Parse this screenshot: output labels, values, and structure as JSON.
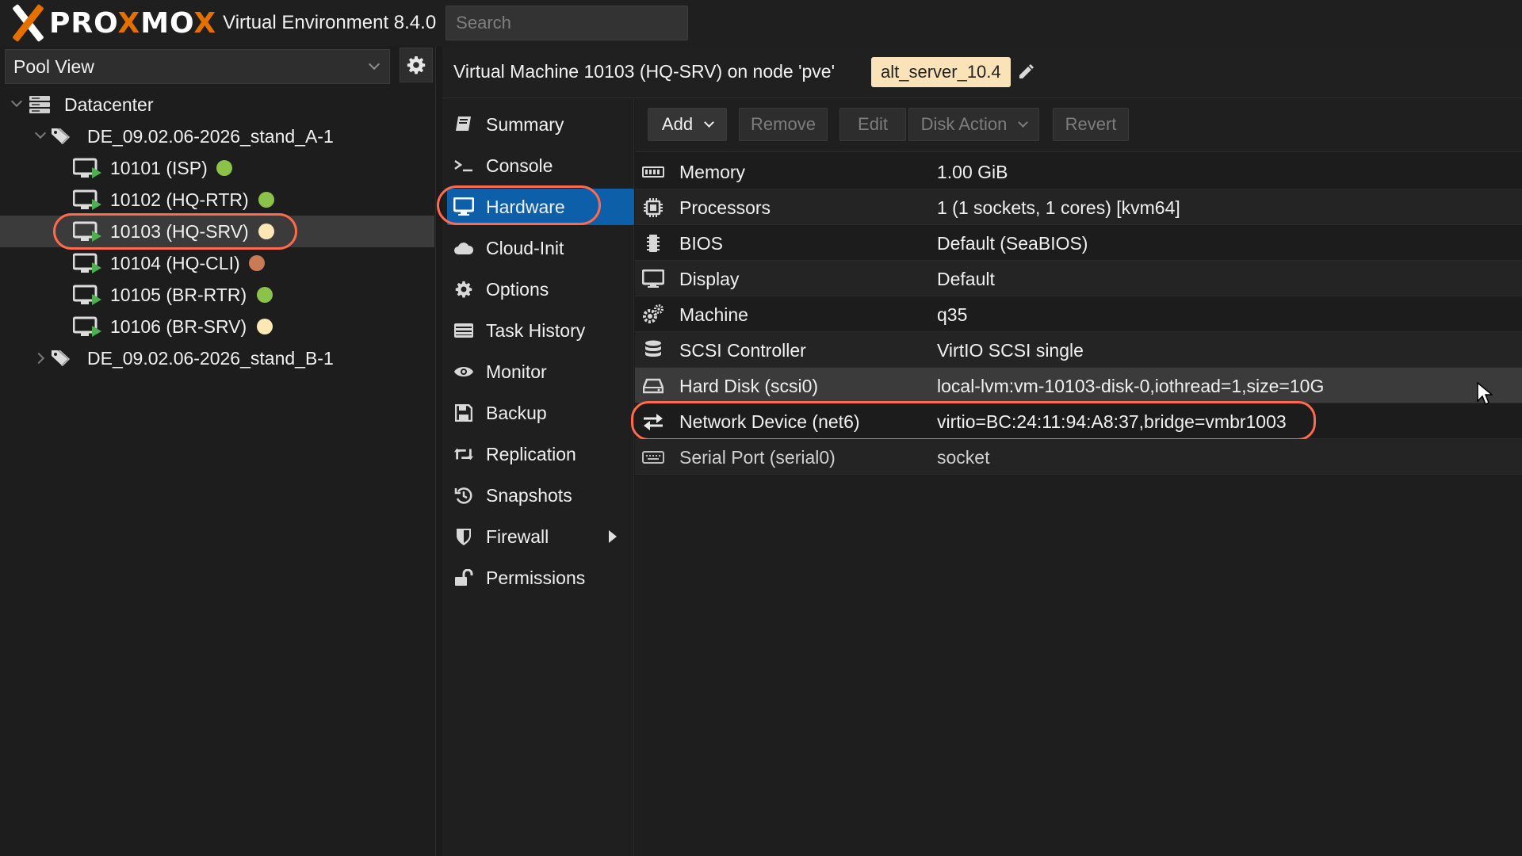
{
  "app": {
    "brand_white_1": "PRO",
    "brand_orange_1": "X",
    "brand_white_2": "MO",
    "brand_orange_2": "X",
    "title": "Virtual Environment 8.4.0",
    "search_placeholder": "Search"
  },
  "left_panel": {
    "view_label": "Pool View",
    "tree": [
      {
        "label": "Datacenter",
        "level": 0,
        "icon": "datacenter-icon"
      },
      {
        "label": "DE_09.02.06-2026_stand_A-1",
        "level": 1,
        "icon": "tags-icon",
        "expanded": true
      },
      {
        "label": "10101 (ISP)",
        "level": 2,
        "icon": "vm-running-icon",
        "status_color": "#8bc34a"
      },
      {
        "label": "10102 (HQ-RTR)",
        "level": 2,
        "icon": "vm-running-icon",
        "status_color": "#8bc34a"
      },
      {
        "label": "10103 (HQ-SRV)",
        "level": 2,
        "icon": "vm-running-icon",
        "status_color": "#fde7b4",
        "selected": true
      },
      {
        "label": "10104 (HQ-CLI)",
        "level": 2,
        "icon": "vm-running-icon",
        "status_color": "#c97a57"
      },
      {
        "label": "10105 (BR-RTR)",
        "level": 2,
        "icon": "vm-running-icon",
        "status_color": "#8bc34a"
      },
      {
        "label": "10106 (BR-SRV)",
        "level": 2,
        "icon": "vm-running-icon",
        "status_color": "#fde7b4"
      },
      {
        "label": "DE_09.02.06-2026_stand_B-1",
        "level": 1,
        "icon": "tags-icon",
        "expanded": false
      }
    ]
  },
  "vm_header": {
    "title": "Virtual Machine 10103 (HQ-SRV) on node 'pve'",
    "tag": "alt_server_10.4"
  },
  "vm_nav": [
    {
      "label": "Summary",
      "icon": "book-icon"
    },
    {
      "label": "Console",
      "icon": "terminal-icon"
    },
    {
      "label": "Hardware",
      "icon": "monitor-icon",
      "active": true
    },
    {
      "label": "Cloud-Init",
      "icon": "cloud-icon"
    },
    {
      "label": "Options",
      "icon": "gear-icon"
    },
    {
      "label": "Task History",
      "icon": "list-icon"
    },
    {
      "label": "Monitor",
      "icon": "eye-icon"
    },
    {
      "label": "Backup",
      "icon": "floppy-icon"
    },
    {
      "label": "Replication",
      "icon": "retweet-icon"
    },
    {
      "label": "Snapshots",
      "icon": "history-icon"
    },
    {
      "label": "Firewall",
      "icon": "shield-icon",
      "has_submenu": true
    },
    {
      "label": "Permissions",
      "icon": "unlock-icon"
    }
  ],
  "toolbar": {
    "add": "Add",
    "remove": "Remove",
    "edit": "Edit",
    "disk_action": "Disk Action",
    "revert": "Revert"
  },
  "hardware": [
    {
      "name": "Memory",
      "value": "1.00 GiB",
      "icon": "memory-icon"
    },
    {
      "name": "Processors",
      "value": "1 (1 sockets, 1 cores) [kvm64]",
      "icon": "cpu-icon"
    },
    {
      "name": "BIOS",
      "value": "Default (SeaBIOS)",
      "icon": "microchip-icon"
    },
    {
      "name": "Display",
      "value": "Default",
      "icon": "desktop-icon"
    },
    {
      "name": "Machine",
      "value": "q35",
      "icon": "cogs-icon"
    },
    {
      "name": "SCSI Controller",
      "value": "VirtIO SCSI single",
      "icon": "database-icon"
    },
    {
      "name": "Hard Disk (scsi0)",
      "value": "local-lvm:vm-10103-disk-0,iothread=1,size=10G",
      "icon": "hdd-icon",
      "selected": true
    },
    {
      "name": "Network Device (net6)",
      "value": "virtio=BC:24:11:94:A8:37,bridge=vmbr1003",
      "icon": "exchange-icon"
    },
    {
      "name": "Serial Port (serial0)",
      "value": "socket",
      "icon": "keyboard-icon",
      "pending": true
    }
  ],
  "colors": {
    "accent_orange": "#e57000",
    "selection_blue": "#0c5fa8",
    "highlight_ring": "#ff6a4d",
    "tag_bg": "#fbe3b9"
  }
}
